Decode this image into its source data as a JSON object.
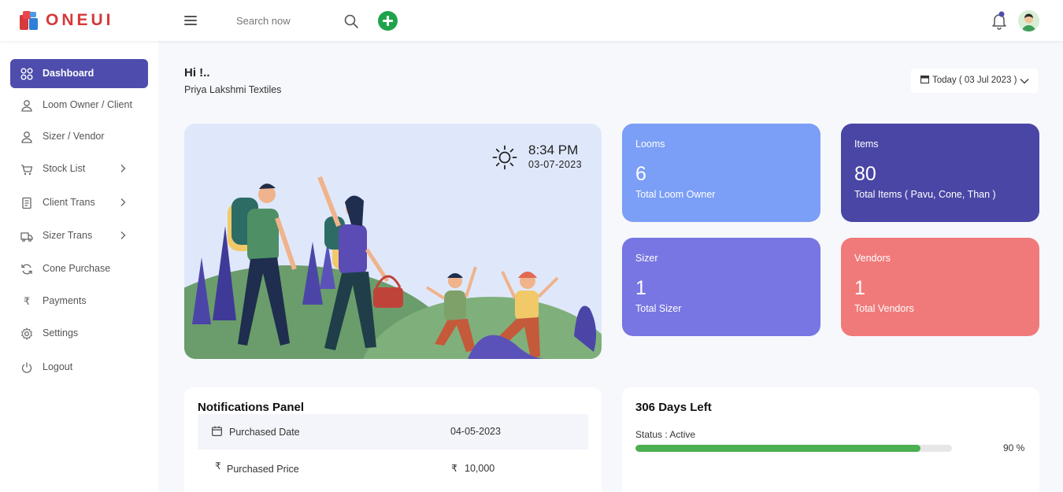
{
  "app": {
    "name": "ONEUI"
  },
  "header": {
    "search": {
      "placeholder": "Search now",
      "value": ""
    }
  },
  "sidebar": {
    "items": [
      {
        "label": "Dashboard",
        "icon": "grid-icon",
        "active": true
      },
      {
        "label": "Loom Owner / Client",
        "icon": "user-icon"
      },
      {
        "label": "Sizer / Vendor",
        "icon": "user-icon"
      },
      {
        "label": "Stock List",
        "icon": "cart-icon",
        "submenu": true
      },
      {
        "label": "Client Trans",
        "icon": "receipt-icon",
        "submenu": true
      },
      {
        "label": "Sizer Trans",
        "icon": "truck-icon",
        "submenu": true
      },
      {
        "label": "Cone Purchase",
        "icon": "refresh-icon"
      },
      {
        "label": "Payments",
        "icon": "rupee-icon"
      },
      {
        "label": "Settings",
        "icon": "gear-icon"
      },
      {
        "label": "Logout",
        "icon": "power-icon"
      }
    ]
  },
  "greeting": {
    "title": "Hi !..",
    "subtitle": "Priya Lakshmi Textiles"
  },
  "date_filter": {
    "label": "Today ( 03 Jul 2023 )"
  },
  "hero": {
    "time": "8:34 PM",
    "date": "03-07-2023"
  },
  "stats": [
    {
      "name": "Looms",
      "value": "6",
      "desc": "Total Loom Owner",
      "color": "#7b9ef6"
    },
    {
      "name": "Items",
      "value": "80",
      "desc": "Total Items ( Pavu, Cone, Than )",
      "color": "#4a46a5"
    },
    {
      "name": "Sizer",
      "value": "1",
      "desc": "Total Sizer",
      "color": "#7876e2"
    },
    {
      "name": "Vendors",
      "value": "1",
      "desc": "Total Vendors",
      "color": "#f07a7a"
    }
  ],
  "notifications": {
    "title": "Notifications Panel",
    "rows": [
      {
        "label": "Purchased Date",
        "value": "04-05-2023",
        "icon": "calendar-icon"
      },
      {
        "label": "Purchased Price",
        "value": "10,000",
        "icon": "rupee-icon",
        "currency": "₹"
      }
    ]
  },
  "subscription": {
    "title": "306 Days Left",
    "status": "Status : Active",
    "percent_label": "90 %",
    "progress": 0.9,
    "bar_color": "#4caf50"
  },
  "colors": {
    "accent": "#4e4dad",
    "add_button": "#1fa34a"
  }
}
